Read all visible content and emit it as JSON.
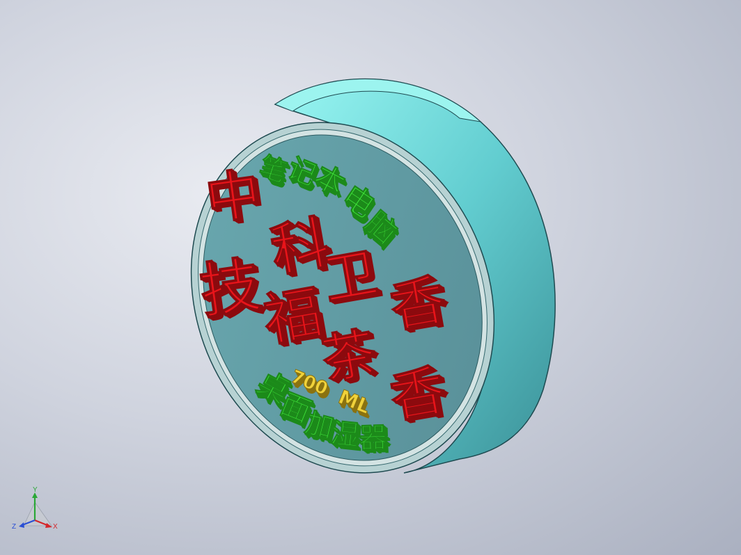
{
  "colors": {
    "background": "#c9cdd8",
    "cylinder_side": "#5fc8cc",
    "cylinder_top": "#8ef0ee",
    "face_plate": "#5f9ea6",
    "rim": "#c8d8d8",
    "red_relief": "#e8141a",
    "red_shadow": "#8c0a0e",
    "green_relief": "#3fe23a",
    "green_shadow": "#1c8a1a",
    "gold_relief": "#f0d23a",
    "gold_shadow": "#8a7210"
  },
  "model": {
    "title": "",
    "red_characters": [
      {
        "name": "char-zhong",
        "glyph": "中"
      },
      {
        "name": "char-ke",
        "glyph": "科"
      },
      {
        "name": "char-ji",
        "glyph": "技"
      },
      {
        "name": "char-fu",
        "glyph": "福"
      },
      {
        "name": "char-wei",
        "glyph": "卫"
      },
      {
        "name": "char-cha",
        "glyph": "茶"
      },
      {
        "name": "char-xiang",
        "glyph": "香"
      }
    ],
    "green_top_text": "笔记本电脑",
    "green_bottom_text": "桌面加湿器",
    "gold_texts": [
      "700",
      "ML"
    ]
  },
  "triad": {
    "x_label": "X",
    "y_label": "Y",
    "z_label": "Z",
    "x_color": "#d4262a",
    "y_color": "#2aa836",
    "z_color": "#2a4fd4"
  }
}
